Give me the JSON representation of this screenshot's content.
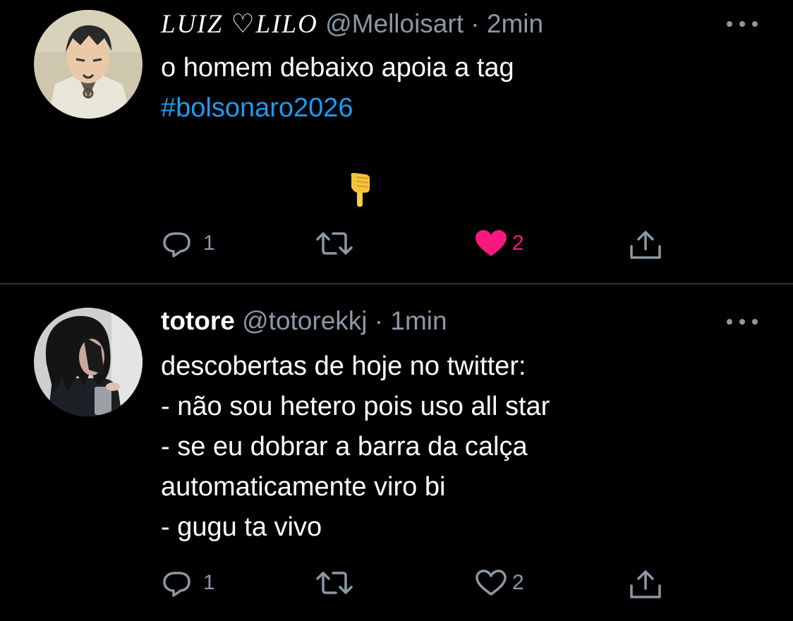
{
  "tweets": [
    {
      "display_name": "LUIZ ♡LILO",
      "handle": "@Melloisart",
      "separator": "·",
      "time": "2min",
      "text_line1": "o homem debaixo apoia a tag",
      "hashtag": "#bolsonaro2026",
      "emoji": "pointing-down-hand",
      "reply_count": "1",
      "retweet_count": "",
      "like_count": "2",
      "liked": true,
      "like_color": "#f91880"
    },
    {
      "display_name": "totore",
      "handle": "@totorekkj",
      "separator": "·",
      "time": "1min",
      "text": "descobertas de hoje no twitter:\n- não sou hetero pois uso all star\n- se eu dobrar a barra da calça\nautomaticamente viro bi\n- gugu ta vivo",
      "reply_count": "1",
      "retweet_count": "",
      "like_count": "2",
      "liked": false
    }
  ],
  "colors": {
    "background": "#000000",
    "text": "#ffffff",
    "secondary": "#8b98a5",
    "link": "#1d9bf0",
    "divider": "#2f3336"
  }
}
